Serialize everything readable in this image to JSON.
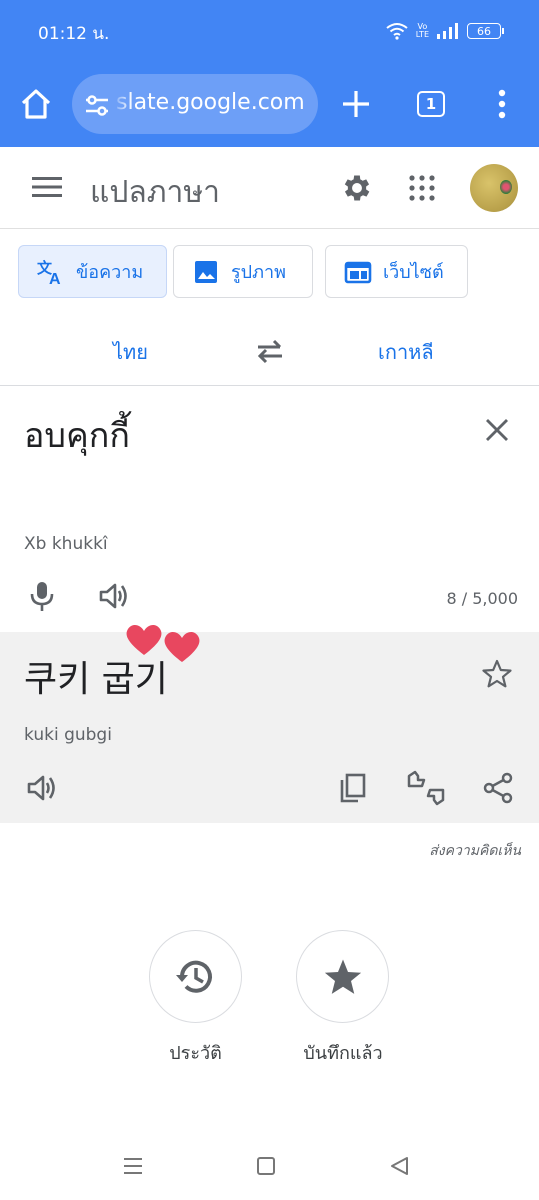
{
  "status_bar": {
    "time": "01:12 น.",
    "volte": "Vo\nLTE",
    "battery": "66"
  },
  "browser": {
    "url": "slate.google.com",
    "tab_count": "1"
  },
  "app": {
    "title": "แปลภาษา"
  },
  "modes": [
    {
      "label": "ข้อความ",
      "icon": "translate-icon",
      "active": true
    },
    {
      "label": "รูปภาพ",
      "icon": "image-icon",
      "active": false
    },
    {
      "label": "เว็บไซต์",
      "icon": "web-icon",
      "active": false
    }
  ],
  "languages": {
    "source": "ไทย",
    "target": "เกาหลี"
  },
  "source": {
    "text": "อบคุกกี้",
    "transliteration": "Xb khukkî",
    "counter": "8 / 5,000"
  },
  "result": {
    "text": "쿠키 굽기",
    "transliteration": "kuki gubgi"
  },
  "feedback": "ส่งความคิดเห็น",
  "bottom_actions": {
    "history": "ประวัติ",
    "saved": "บันทึกแล้ว"
  },
  "colors": {
    "chrome": "#4285f4",
    "accent": "#1a73e8",
    "heart": "#e8475f",
    "result_bg": "#f1f1f1"
  }
}
